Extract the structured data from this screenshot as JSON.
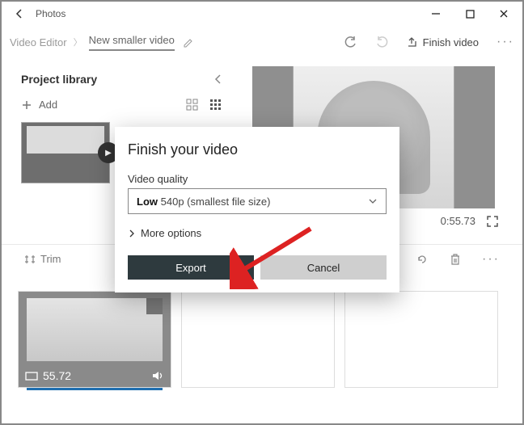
{
  "app": {
    "title": "Photos"
  },
  "breadcrumb": {
    "root": "Video Editor",
    "current": "New smaller video"
  },
  "toolbar": {
    "finish_label": "Finish video"
  },
  "sidebar": {
    "heading": "Project library",
    "add_label": "Add"
  },
  "preview": {
    "time": "0:55.73"
  },
  "storyboard": {
    "trim_label": "Trim"
  },
  "clip": {
    "duration": "55.72"
  },
  "dialog": {
    "title": "Finish your video",
    "quality_label": "Video quality",
    "quality_value_prefix": "Low",
    "quality_value_rest": "540p (smallest file size)",
    "more_options": "More options",
    "export_label": "Export",
    "cancel_label": "Cancel"
  }
}
